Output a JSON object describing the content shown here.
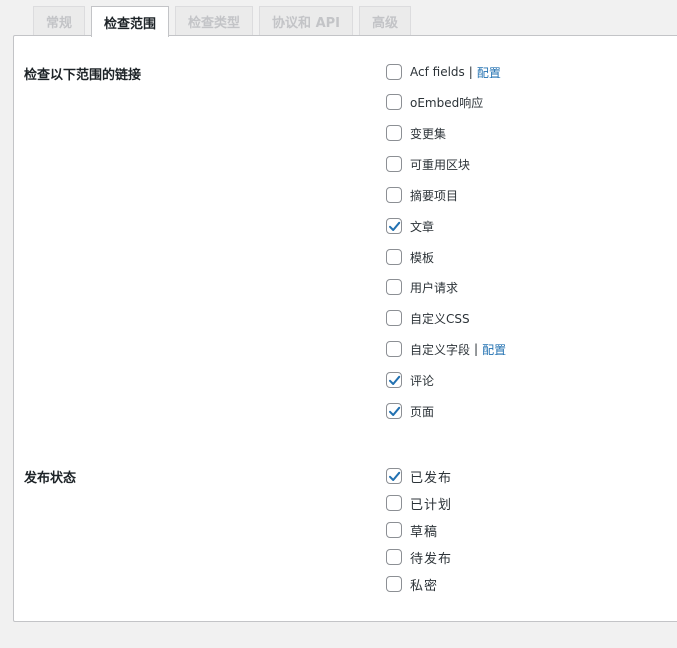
{
  "tabs": [
    {
      "label": "常规",
      "active": false
    },
    {
      "label": "检查范围",
      "active": true
    },
    {
      "label": "检查类型",
      "active": false
    },
    {
      "label": "协议和 API",
      "active": false
    },
    {
      "label": "高级",
      "active": false
    }
  ],
  "scope": {
    "title": "检查以下范围的链接",
    "items": [
      {
        "label": "Acf fields",
        "checked": false,
        "link": "配置"
      },
      {
        "label": "oEmbed响应",
        "checked": false
      },
      {
        "label": "变更集",
        "checked": false
      },
      {
        "label": "可重用区块",
        "checked": false
      },
      {
        "label": "摘要项目",
        "checked": false
      },
      {
        "label": "文章",
        "checked": true
      },
      {
        "label": "模板",
        "checked": false
      },
      {
        "label": "用户请求",
        "checked": false
      },
      {
        "label": "自定义CSS",
        "checked": false
      },
      {
        "label": "自定义字段",
        "checked": false,
        "link": "配置"
      },
      {
        "label": "评论",
        "checked": true
      },
      {
        "label": "页面",
        "checked": true
      }
    ]
  },
  "status": {
    "title": "发布状态",
    "items": [
      {
        "label": "已发布",
        "checked": true
      },
      {
        "label": "已计划",
        "checked": false
      },
      {
        "label": "草稿",
        "checked": false
      },
      {
        "label": "待发布",
        "checked": false
      },
      {
        "label": "私密",
        "checked": false
      }
    ]
  },
  "colors": {
    "accent": "#2271b1",
    "background": "#f1f1f1",
    "panel": "#ffffff",
    "border": "#c3c4c7"
  },
  "icons": {
    "checkbox_checked": "checkmark-icon"
  }
}
